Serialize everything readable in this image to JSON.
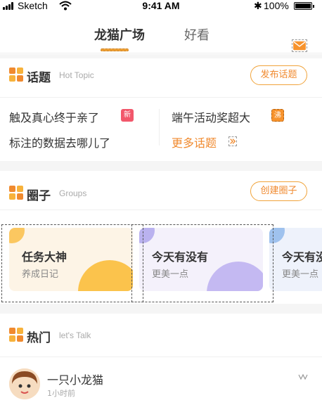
{
  "status_bar": {
    "carrier": "Sketch",
    "time": "9:41 AM",
    "battery": "100%",
    "bluetooth_glyph": "✱",
    "battery_level": 1.0
  },
  "nav": {
    "tabs": [
      "龙猫广场",
      "好看"
    ],
    "active_tab": "龙猫广场",
    "mail_icon": "mail-icon"
  },
  "topics": {
    "title": "话题",
    "subtitle": "Hot Topic",
    "action": "发布话题",
    "items": [
      {
        "text": "触及真心终于亲了",
        "badge": "新"
      },
      {
        "text": "端午活动奖超大",
        "badge": "沸"
      },
      {
        "text": "标注的数据去哪儿了",
        "badge": ""
      }
    ],
    "more": "更多话题"
  },
  "groups": {
    "title": "圈子",
    "subtitle": "Groups",
    "action": "创建圈子",
    "cards": [
      {
        "title": "任务大神",
        "subtitle": "养成日记"
      },
      {
        "title": "今天有没有",
        "subtitle": "更美一点"
      },
      {
        "title": "今天有没",
        "subtitle": "更美一点"
      }
    ]
  },
  "hot": {
    "title": "热门",
    "subtitle": "let's Talk",
    "post": {
      "user": "一只小龙猫",
      "time": "1小时前"
    }
  },
  "colors": {
    "accent": "#f08a2f",
    "new_badge": "#f2576b",
    "hot_badge": "#f7932d"
  }
}
